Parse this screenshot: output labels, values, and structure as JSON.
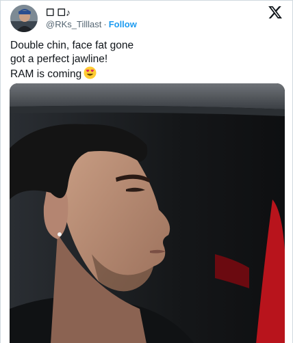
{
  "author": {
    "display_name": "☐ ☐♪",
    "handle": "@RKs_Tilllast",
    "separator": "·",
    "follow_label": "Follow"
  },
  "tweet": {
    "lines": [
      "Double chin, face fat gone",
      "got a perfect jawline!",
      "RAM is coming"
    ],
    "emoji": "heart-eyes-emoji"
  },
  "icons": {
    "brand": "x-logo-icon",
    "avatar": "avatar"
  },
  "colors": {
    "text": "#0f1419",
    "secondary": "#536471",
    "accent": "#1d9bf0",
    "border": "#cfd9de"
  }
}
